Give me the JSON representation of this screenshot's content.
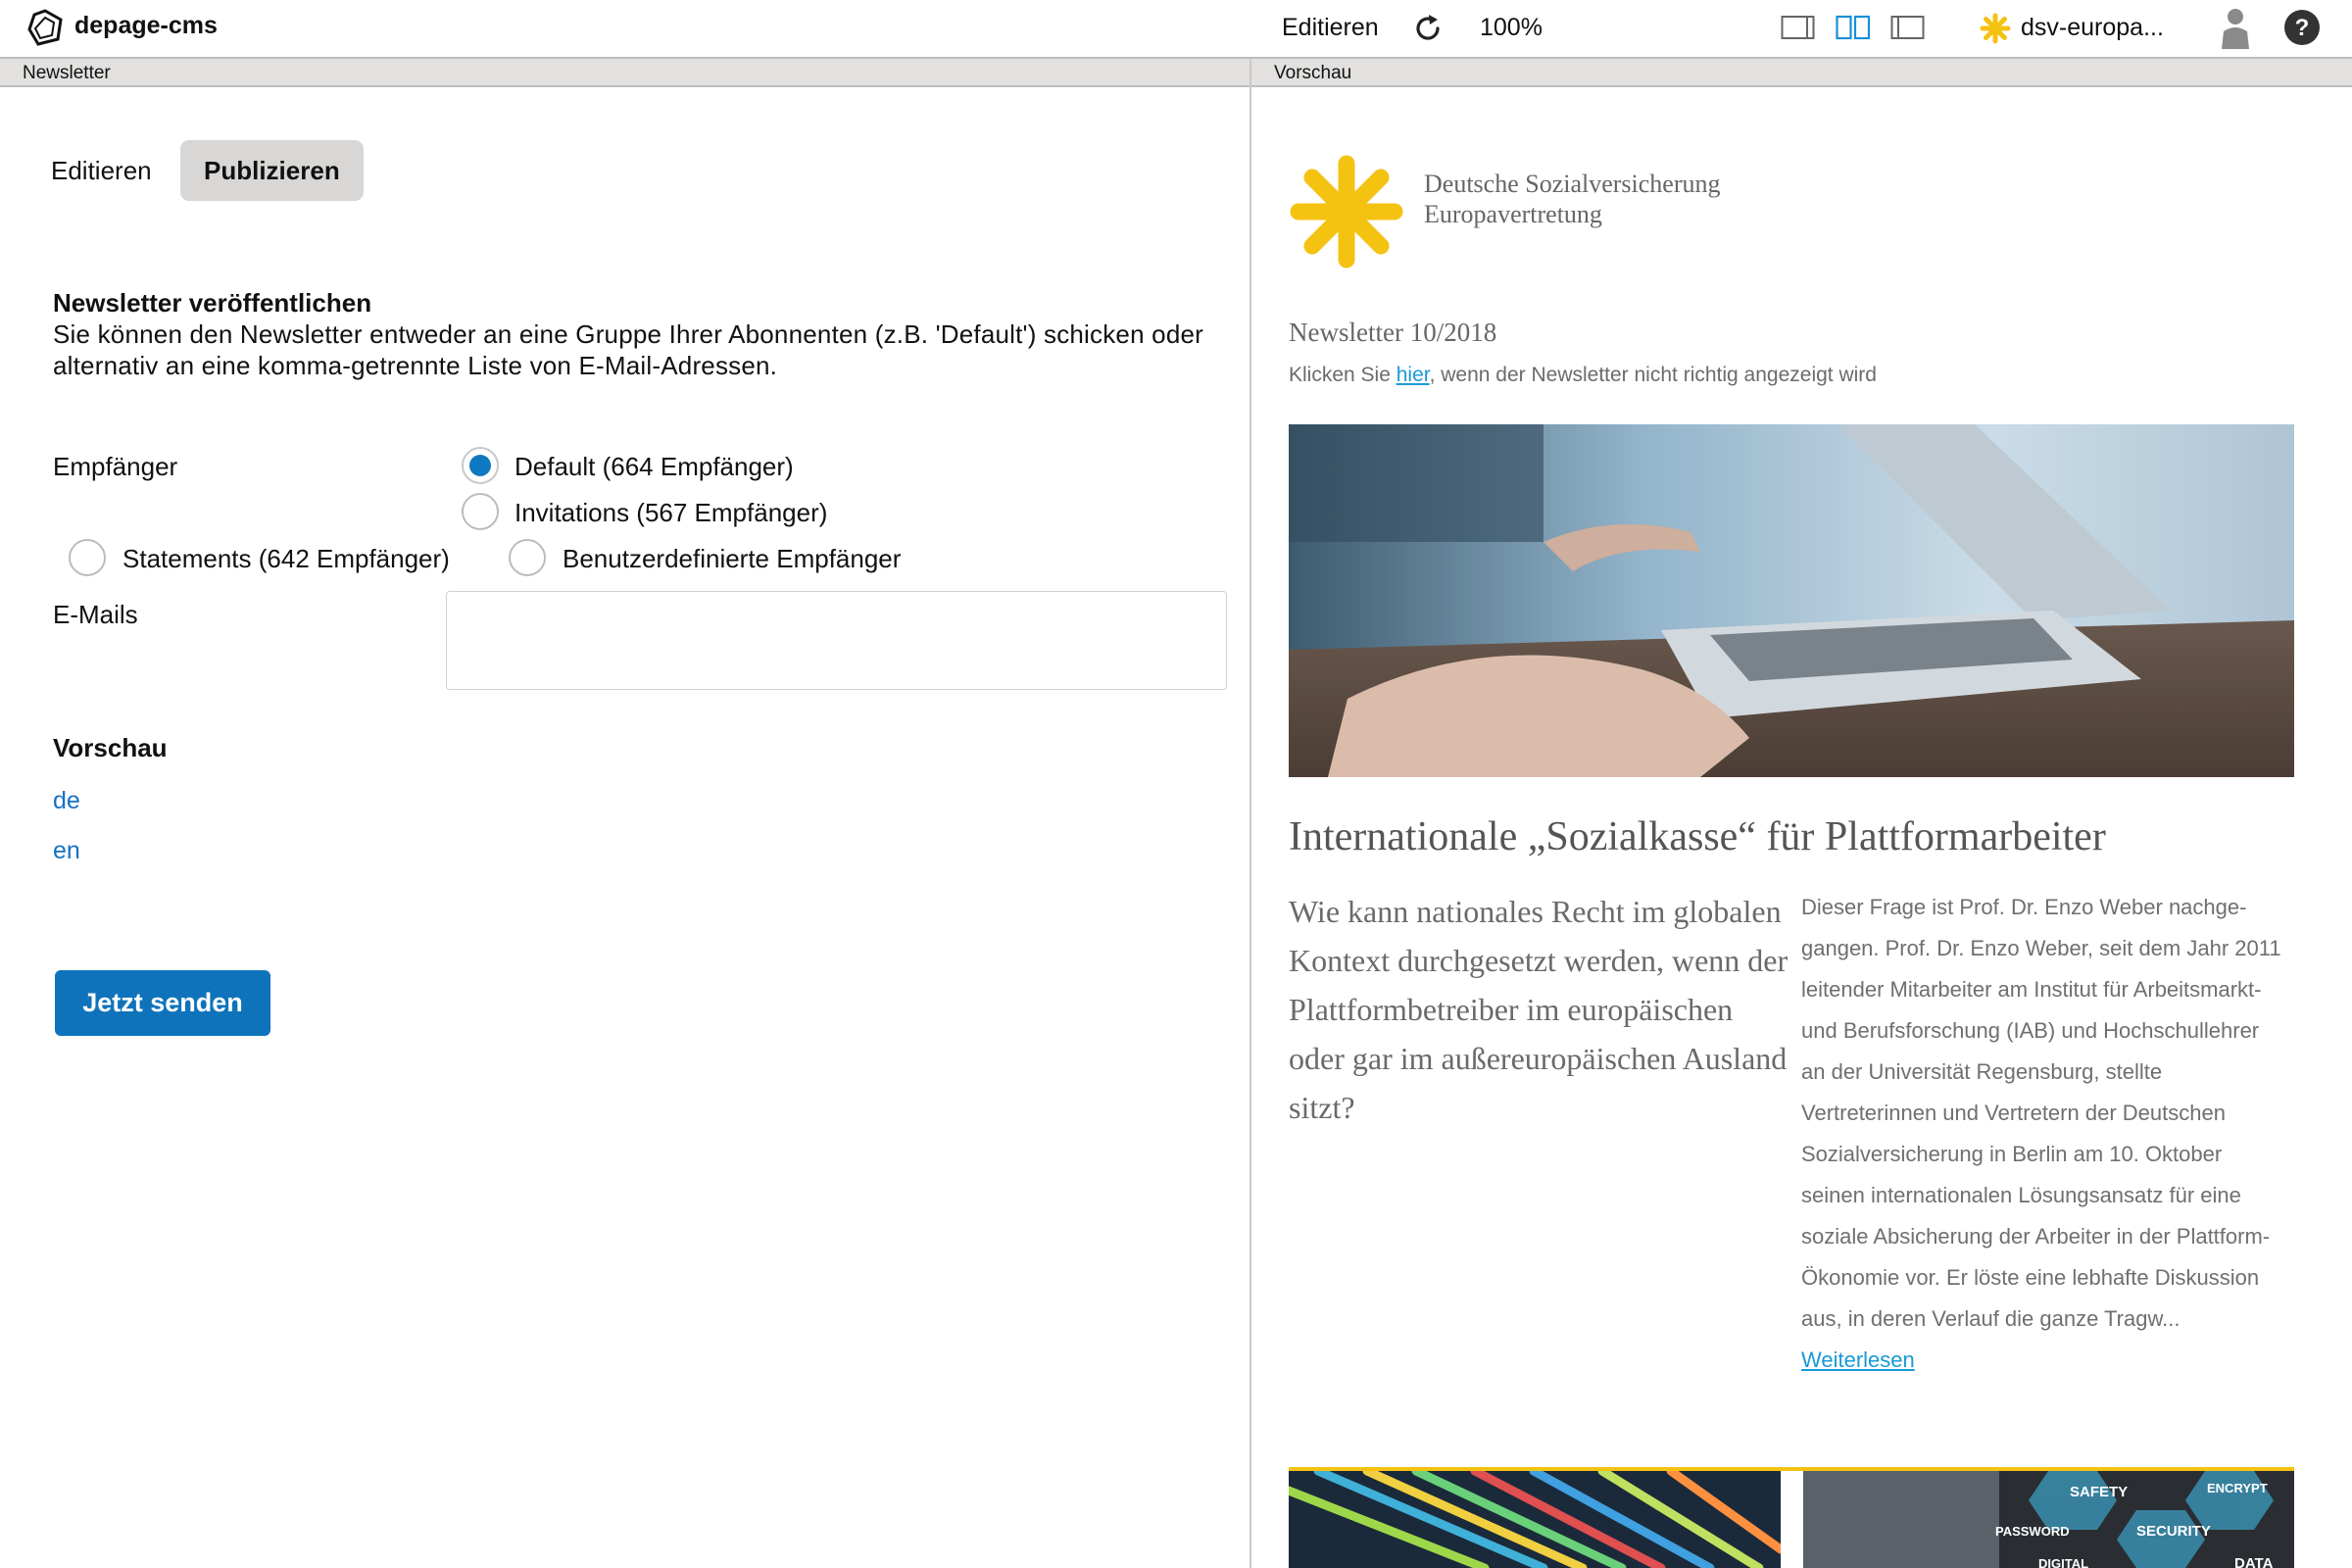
{
  "app": {
    "title": "depage-cms"
  },
  "toolbar": {
    "mode_label": "Editieren",
    "zoom": "100%",
    "project_name": "dsv-europa..."
  },
  "panes": {
    "left_title": "Newsletter",
    "right_title": "Vorschau"
  },
  "tabs": [
    {
      "label": "Editieren",
      "active": false
    },
    {
      "label": "Publizieren",
      "active": true
    }
  ],
  "publish": {
    "title": "Newsletter veröffentlichen",
    "description": "Sie können den Newsletter entweder an eine Gruppe Ihrer Abonnenten (z.B. 'Default') schicken oder alternativ an eine komma-getrennte Liste von E-Mail-Adressen.",
    "recipients_label": "Empfänger",
    "recipients": [
      {
        "label": "Default (664 Empfänger)",
        "checked": true
      },
      {
        "label": "Invitations (567 Empfänger)",
        "checked": false
      },
      {
        "label": "Statements (642 Empfänger)",
        "checked": false
      },
      {
        "label": "Benutzerdefinierte Empfänger",
        "checked": false
      }
    ],
    "emails_label": "E-Mails",
    "emails_value": "",
    "preview_heading": "Vorschau",
    "preview_links": [
      "de",
      "en"
    ],
    "send_label": "Jetzt senden"
  },
  "preview": {
    "org_line1": "Deutsche Sozialversicherung",
    "org_line2": "Europavertretung",
    "issue": "Newsletter 10/2018",
    "hint_before": "Klicken Sie ",
    "hint_link": "hier",
    "hint_after": ", wenn der Newsletter nicht richtig angezeigt wird",
    "article_title": "Internationale „Sozialkasse“ für Plattformarbeiter",
    "lead": "Wie kann nationales Recht im glo­balen Kontext durchgesetzt werden, wenn der Plattformbetreiber im eu­ropäischen oder gar im außereuro­päischen Ausland sitzt?",
    "body": "Dieser Frage ist Prof. Dr. Enzo Weber nachge­gangen. Prof. Dr. Enzo Weber, seit dem Jahr 2011 leitender Mitarbeiter am Institut für Arbeitsmarkt- und Berufsforschung (IAB) und Hochschullehrer an der Universität Regens­burg, stellte Vertreterinnen und Vertretern der Deutschen Sozialversicherung in Berlin am 10. Oktober seinen internationalen Lösungsansatz für eine soziale Absicherung der Arbeiter in der Plattform-Ökonomie vor. Er löste eine leb­hafte Diskussion aus, in deren Verlauf die gan­ze Tragw...",
    "read_more": "Weiterlesen",
    "thumb2_words": [
      "SAFETY",
      "ENCRYPT",
      "PASSWORD",
      "SECURITY",
      "DIGITAL",
      "DATA"
    ]
  },
  "colors": {
    "accent_blue": "#0e73bb",
    "link_blue": "#1a9ad6",
    "brand_yellow": "#f4c211",
    "header_gray": "#e3e1df"
  }
}
